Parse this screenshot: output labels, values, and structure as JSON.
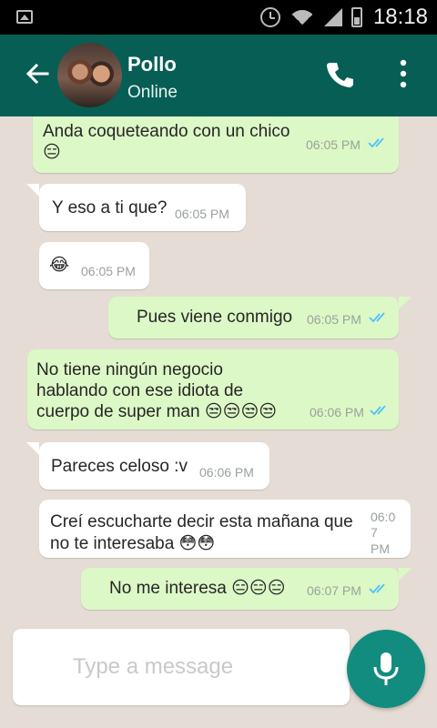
{
  "status_bar": {
    "time": "18:18"
  },
  "header": {
    "contact_name": "Pollo",
    "status": "Online"
  },
  "messages": [
    {
      "direction": "out",
      "text": "Anda coqueteando con un chico",
      "emoji": "😑",
      "time": "06:05 PM",
      "read": true
    },
    {
      "direction": "in",
      "text": "Y eso a ti que?",
      "time": "06:05 PM"
    },
    {
      "direction": "in",
      "text": "😂",
      "time": "06:05 PM"
    },
    {
      "direction": "out",
      "text": "Pues viene conmigo",
      "time": "06:05 PM",
      "read": true
    },
    {
      "direction": "out",
      "text_lines": [
        "No tiene ningún negocio",
        "hablando con ese idiota de",
        "cuerpo de super man 😒😒😒😒"
      ],
      "time": "06:06 PM",
      "read": true
    },
    {
      "direction": "in",
      "text": "Pareces celoso :v",
      "time": "06:06 PM"
    },
    {
      "direction": "in",
      "text_lines": [
        "Creí escucharte decir esta mañana que",
        "no te interesaba 😳😳"
      ],
      "time_lines": [
        "06:0",
        "7",
        "PM"
      ]
    },
    {
      "direction": "out",
      "text": "No me interesa 😑😑😑",
      "time": "06:07 PM",
      "read": true
    }
  ],
  "composer": {
    "placeholder": "Type a message"
  },
  "colors": {
    "header": "#075e54",
    "outgoing_bubble": "#dcf8c6",
    "incoming_bubble": "#ffffff",
    "chat_background": "#e5ddd5",
    "read_ticks": "#4fc3f7",
    "mic_button": "#128c7e"
  },
  "icons": [
    "back-arrow-icon",
    "phone-icon",
    "more-options-icon",
    "microphone-icon",
    "alarm-icon",
    "wifi-icon",
    "signal-icon",
    "battery-icon",
    "image-notification-icon"
  ]
}
